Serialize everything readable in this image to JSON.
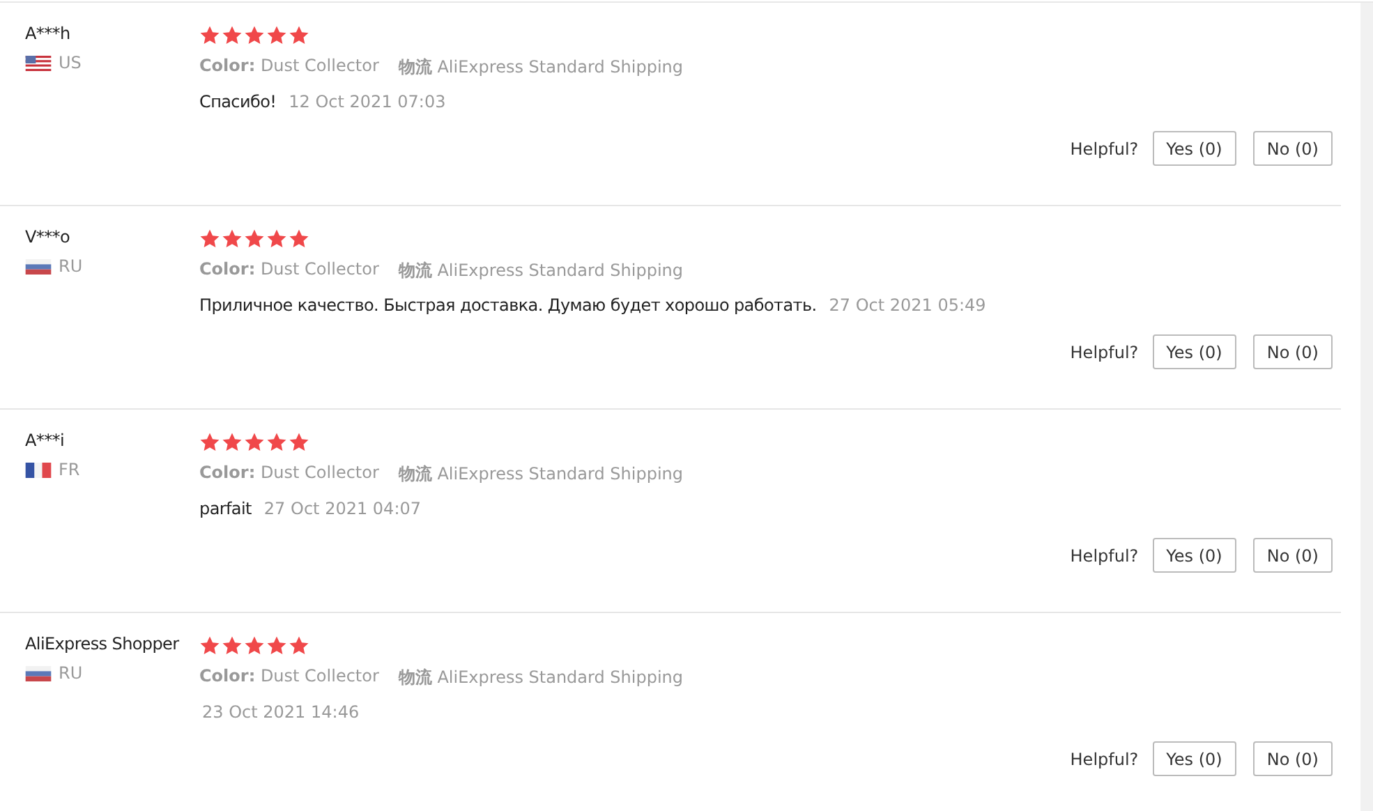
{
  "reviews": [
    {
      "name": "A***h",
      "kind": "us",
      "country": "US",
      "stars": 5,
      "color_label": "Color:",
      "color_value": "Dust Collector",
      "shipping_label": "物流",
      "shipping_value": "AliExpress Standard Shipping",
      "comment": "Спасибо!",
      "date": "12 Oct 2021 07:03",
      "helpful": "Helpful?",
      "yes": "Yes (0)",
      "no": "No (0)"
    },
    {
      "name": "V***o",
      "kind": "ru",
      "country": "RU",
      "stars": 5,
      "color_label": "Color:",
      "color_value": "Dust Collector",
      "shipping_label": "物流",
      "shipping_value": "AliExpress Standard Shipping",
      "comment": "Приличное качество. Быстрая доставка. Думаю будет хорошо работать.",
      "date": "27 Oct 2021 05:49",
      "helpful": "Helpful?",
      "yes": "Yes (0)",
      "no": "No (0)"
    },
    {
      "name": "A***i",
      "kind": "fr",
      "country": "FR",
      "stars": 5,
      "color_label": "Color:",
      "color_value": "Dust Collector",
      "shipping_label": "物流",
      "shipping_value": "AliExpress Standard Shipping",
      "comment": "parfait",
      "date": "27 Oct 2021 04:07",
      "helpful": "Helpful?",
      "yes": "Yes (0)",
      "no": "No (0)"
    },
    {
      "name": "AliExpress Shopper",
      "kind": "ru",
      "country": "RU",
      "stars": 5,
      "color_label": "Color:",
      "color_value": "Dust Collector",
      "shipping_label": "物流",
      "shipping_value": "AliExpress Standard Shipping",
      "date": "23 Oct 2021 14:46",
      "helpful": "Helpful?",
      "yes": "Yes (0)",
      "no": "No (0)"
    }
  ]
}
